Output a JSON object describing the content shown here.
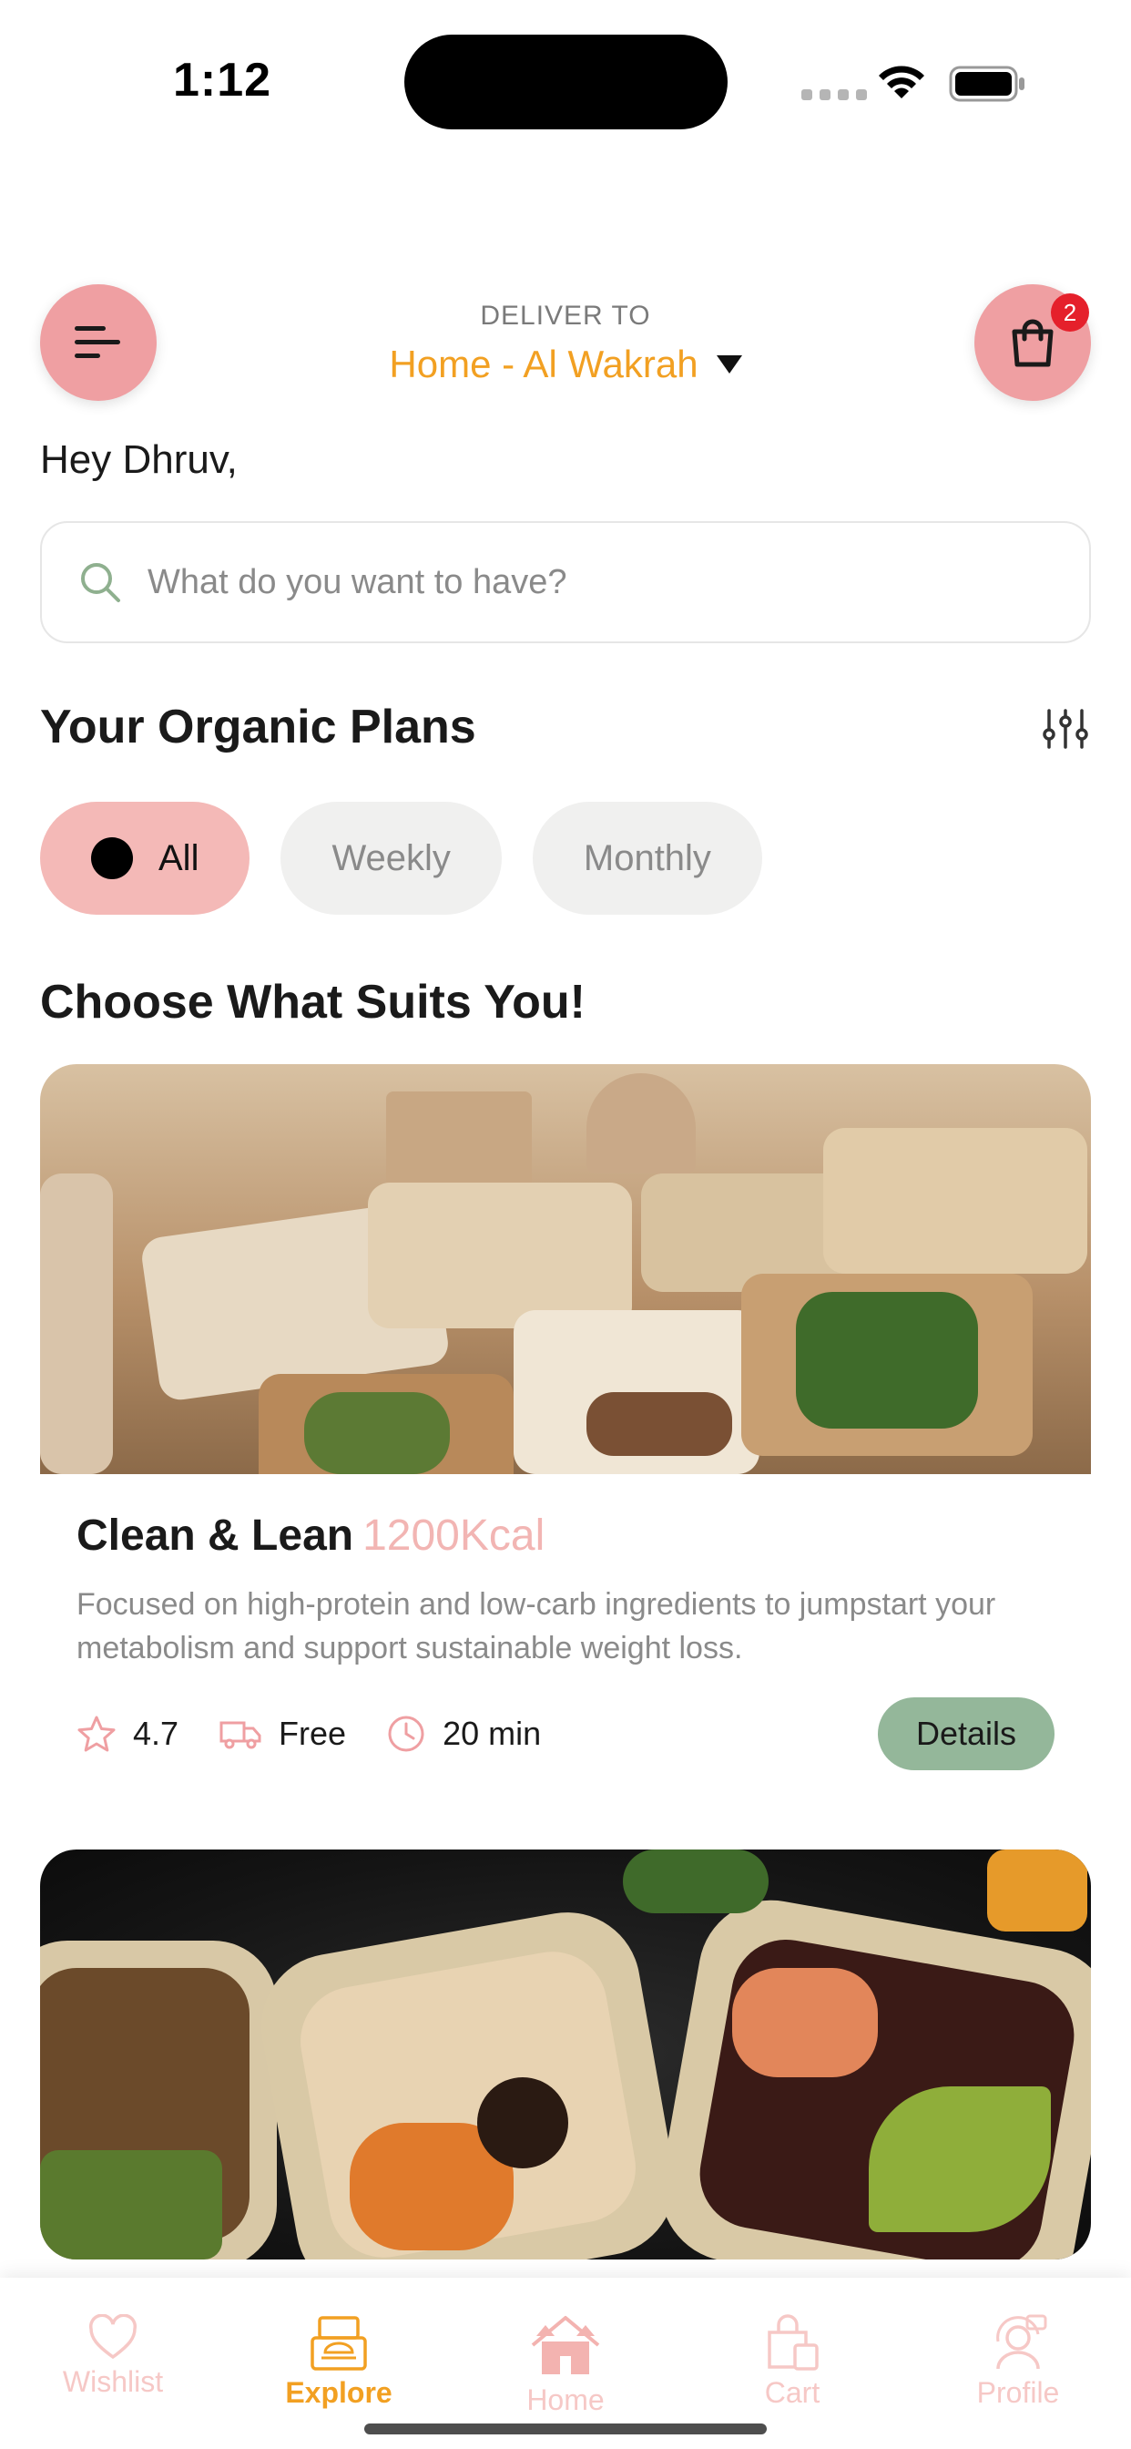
{
  "status_bar": {
    "time": "1:12"
  },
  "header": {
    "deliver_label": "DELIVER TO",
    "deliver_location": "Home - Al Wakrah",
    "cart_count": "2"
  },
  "greeting": "Hey Dhruv,",
  "search": {
    "placeholder": "What do you want to have?"
  },
  "plans": {
    "title": "Your Organic Plans",
    "chips": [
      {
        "label": "All",
        "active": true
      },
      {
        "label": "Weekly",
        "active": false
      },
      {
        "label": "Monthly",
        "active": false
      }
    ]
  },
  "choose_title": "Choose What Suits You!",
  "cards": [
    {
      "title": "Clean & Lean",
      "kcal": "1200Kcal",
      "description": "Focused on high-protein and low-carb ingredients to jumpstart your metabolism and support sustainable weight loss.",
      "rating": "4.7",
      "delivery": "Free",
      "time": "20 min",
      "details_label": "Details"
    }
  ],
  "tabs": [
    {
      "label": "Wishlist",
      "icon": "heart-icon"
    },
    {
      "label": "Explore",
      "icon": "food-box-icon",
      "active": true
    },
    {
      "label": "Home",
      "icon": "house-icon"
    },
    {
      "label": "Cart",
      "icon": "shopping-bag-icon"
    },
    {
      "label": "Profile",
      "icon": "user-icon"
    }
  ],
  "colors": {
    "accent_pink": "#ef9fa2",
    "accent_orange": "#f2a022",
    "details_green": "#94b79a",
    "badge_red": "#e5202b"
  }
}
